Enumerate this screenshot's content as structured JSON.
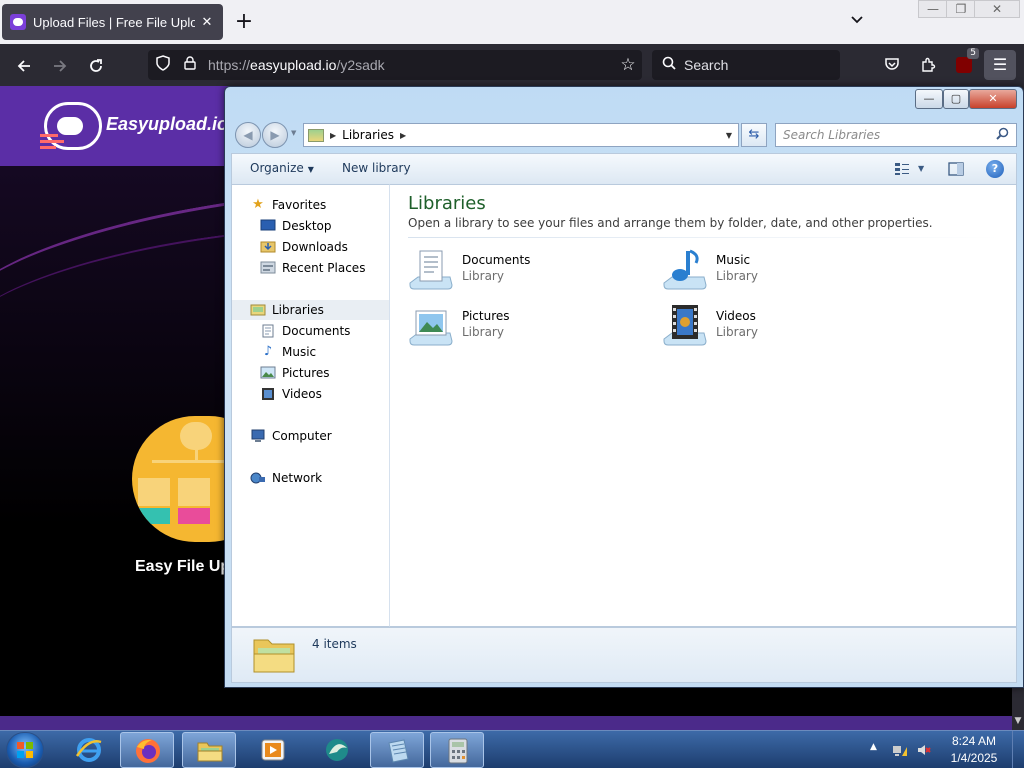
{
  "browser": {
    "tab_title": "Upload Files | Free File Upload a",
    "tab_close": "✕",
    "new_tab": "+",
    "url_scheme": "https://",
    "url_host": "easyupload.io",
    "url_path": "/y2sadk",
    "search_placeholder": "Search",
    "extension_badge": "5",
    "icons": [
      "back-arrow-icon",
      "forward-arrow-icon",
      "reload-icon",
      "shield-icon",
      "lock-icon",
      "bookmark-star-icon",
      "search-icon",
      "pocket-icon",
      "extensions-icon",
      "ublock-icon",
      "hamburger-menu-icon"
    ]
  },
  "webpage": {
    "logo_text": "Easyupload.io",
    "caption": "Easy File Up",
    "brand_color": "#5b2ea6"
  },
  "explorer": {
    "window_controls": {
      "minimize": "—",
      "maximize": "▢",
      "close": "✕"
    },
    "breadcrumb": [
      "Libraries"
    ],
    "search_placeholder": "Search Libraries",
    "commands": {
      "organize": "Organize",
      "new_library": "New library"
    },
    "nav": {
      "favorites": "Favorites",
      "desktop": "Desktop",
      "downloads": "Downloads",
      "recent_places": "Recent Places",
      "libraries": "Libraries",
      "documents": "Documents",
      "music": "Music",
      "pictures": "Pictures",
      "videos": "Videos",
      "computer": "Computer",
      "network": "Network"
    },
    "title": "Libraries",
    "subtitle": "Open a library to see your files and arrange them by folder, date, and other properties.",
    "libraries": [
      {
        "name": "Documents",
        "type": "Library",
        "icon": "documents-library-icon"
      },
      {
        "name": "Music",
        "type": "Library",
        "icon": "music-library-icon"
      },
      {
        "name": "Pictures",
        "type": "Library",
        "icon": "pictures-library-icon"
      },
      {
        "name": "Videos",
        "type": "Library",
        "icon": "videos-library-icon"
      }
    ],
    "status": "4 items"
  },
  "taskbar": {
    "apps": [
      "internet-explorer-icon",
      "firefox-icon",
      "windows-explorer-icon",
      "media-player-icon",
      "app-icon",
      "notepad-icon",
      "calculator-icon"
    ],
    "time": "8:24 AM",
    "date": "1/4/2025"
  }
}
